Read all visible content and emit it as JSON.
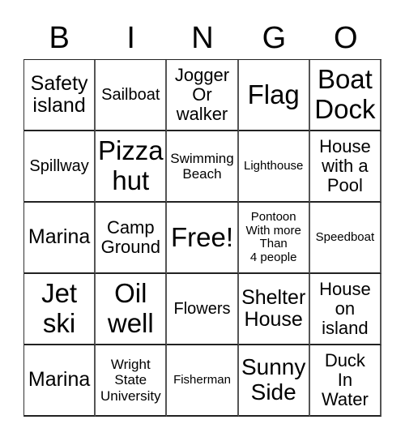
{
  "card": {
    "header": [
      "B",
      "I",
      "N",
      "G",
      "O"
    ],
    "rows": [
      [
        {
          "text": "Safety\nisland",
          "size": "m"
        },
        {
          "text": "Sailboat",
          "size": "s"
        },
        {
          "text": "Jogger\nOr\nwalker",
          "size": "ml"
        },
        {
          "text": "Flag",
          "size": "xl"
        },
        {
          "text": "Boat\nDock",
          "size": "xl"
        }
      ],
      [
        {
          "text": "Spillway",
          "size": "s"
        },
        {
          "text": "Pizza\nhut",
          "size": "xl"
        },
        {
          "text": "Swimming\nBeach",
          "size": "xs"
        },
        {
          "text": "Lighthouse",
          "size": "xxs"
        },
        {
          "text": "House\nwith a\nPool",
          "size": "ml"
        }
      ],
      [
        {
          "text": "Marina",
          "size": "m"
        },
        {
          "text": "Camp\nGround",
          "size": "ml"
        },
        {
          "text": "Free!",
          "size": "xl"
        },
        {
          "text": "Pontoon\nWith more\nThan\n4 people",
          "size": "xxs"
        },
        {
          "text": "Speedboat",
          "size": "xxs"
        }
      ],
      [
        {
          "text": "Jet\nski",
          "size": "xl"
        },
        {
          "text": "Oil\nwell",
          "size": "xl"
        },
        {
          "text": "Flowers",
          "size": "s"
        },
        {
          "text": "Shelter\nHouse",
          "size": "m"
        },
        {
          "text": "House\non\nisland",
          "size": "ml"
        }
      ],
      [
        {
          "text": "Marina",
          "size": "m"
        },
        {
          "text": "Wright\nState\nUniversity",
          "size": "xs"
        },
        {
          "text": "Fisherman",
          "size": "xxs"
        },
        {
          "text": "Sunny\nSide",
          "size": "l"
        },
        {
          "text": "Duck\nIn\nWater",
          "size": "ml"
        }
      ]
    ]
  }
}
